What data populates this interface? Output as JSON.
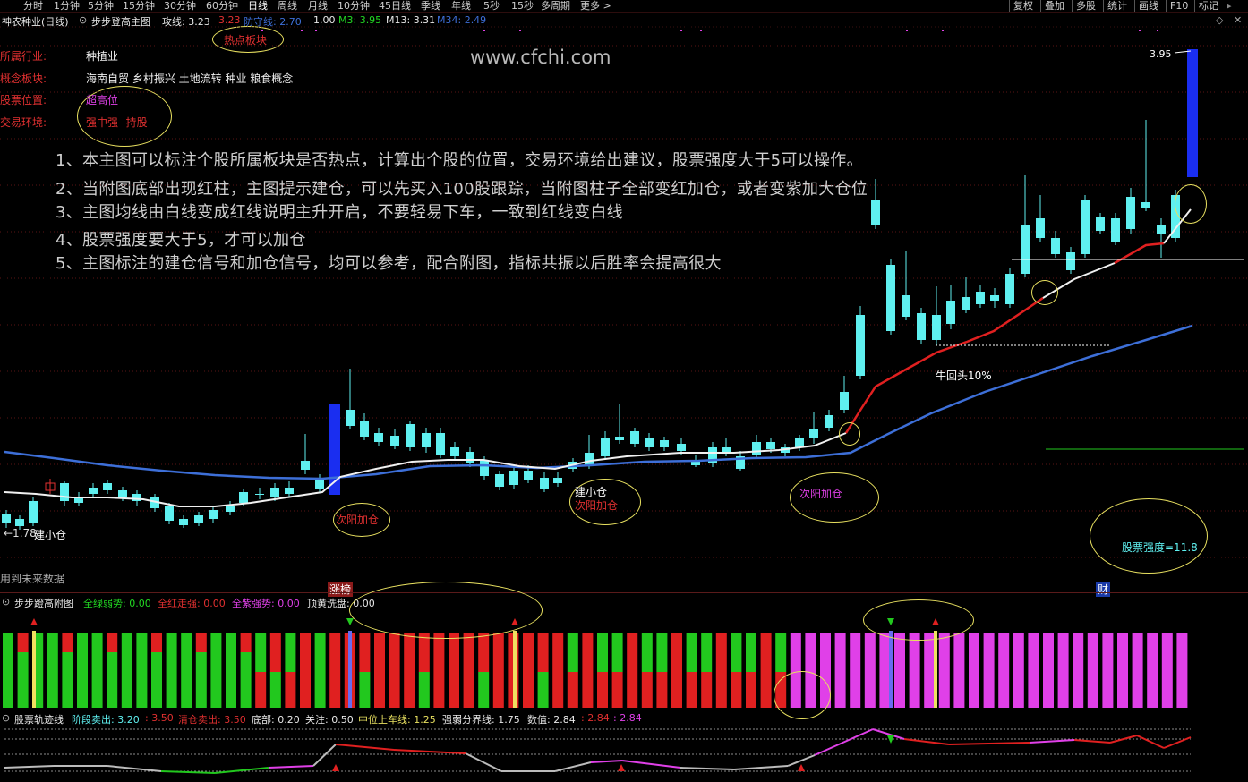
{
  "toolbar": {
    "periods": [
      "分时",
      "1分钟",
      "5分钟",
      "15分钟",
      "30分钟",
      "60分钟",
      "日线",
      "周线",
      "月线",
      "10分钟",
      "45日线",
      "季线",
      "年线",
      "5秒",
      "15秒",
      "多周期",
      "更多 >"
    ],
    "right_buttons": [
      "复权",
      "叠加",
      "多股",
      "统计",
      "画线",
      "F10",
      "标记"
    ]
  },
  "main_header": {
    "stock": "神农种业(日线)",
    "indicator": "步步登高主图",
    "attack": "攻线: 3.23",
    "attack2": "3.23",
    "defend": "防守线: 2.70",
    "v100": "1.00",
    "m3": "M3: 3.95",
    "m13": "M13: 3.31",
    "m34": "M34: 2.49"
  },
  "info": {
    "industry_label": "所属行业:",
    "industry": "种植业",
    "concept_label": "概念板块:",
    "concept": "海南自贸 乡村振兴 土地流转 种业 粮食概念",
    "position_label": "股票位置:",
    "position": "超高位",
    "env_label": "交易环境:",
    "env": "强中强--持股"
  },
  "watermark": "www.cfchi.com",
  "hot_label": "热点板块",
  "notes": [
    "1、本主图可以标注个股所属板块是否热点，计算出个股的位置，交易环境给出建议，股票强度大于5可以操作。",
    "2、当附图底部出现红柱，主图提示建仓，可以先买入100股跟踪，当附图柱子全部变红加仓，或者变紫加大仓位",
    "3、主图均线由白线变成红线说明主升开启，不要轻易下车，一致到红线变白线",
    "4、股票强度要大于5，才可以加仓",
    "5、主图标注的建仓信号和加仓信号，均可以参考，配合附图，指标共振以后胜率会提高很大"
  ],
  "chart_labels": {
    "low_price": "←1.78",
    "build_small": "建小仓",
    "second_yang": "次阳加仓",
    "build_small2": "建小仓",
    "second_yang2": "次阳加仓",
    "second_yang3": "次阳加仓",
    "bull_return": "牛回头10%",
    "high_price": "3.95",
    "strength": "股票强度=11.8",
    "future_data": "用到未来数据",
    "limit_up": "涨榜",
    "cai": "财"
  },
  "sub1_header": {
    "name": "步步蹬高附图",
    "green": "全绿弱势: 0.00",
    "red": "全红走强: 0.00",
    "purple": "全紫强势: 0.00",
    "yellow": "顶黄洗盘: 0.00"
  },
  "sub2_header": {
    "name": "股票轨迹线",
    "stage_sell": "阶段卖出: 3.20",
    "stage_sell2": ": 3.50",
    "clear_sell": "清仓卖出: 3.50",
    "bottom": "底部: 0.20",
    "focus": "关注: 0.50",
    "mid_on": "中位上车线: 1.25",
    "divide": "强弱分界线: 1.75",
    "value": "数值: 2.84",
    "value2": ": 2.84",
    "value3": ": 2.84"
  },
  "colors": {
    "up": "#e03030",
    "down": "#5ff0f0",
    "green": "#22c81e",
    "purple": "#e040e8",
    "ma_blue": "#3d6fd8",
    "yellow": "#e8e060"
  }
}
